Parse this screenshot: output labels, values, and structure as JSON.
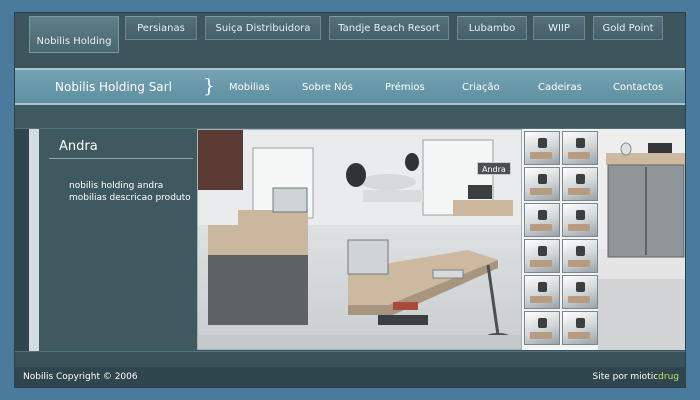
{
  "top_tabs": [
    {
      "label": "Nobilis Holding",
      "active": true
    },
    {
      "label": "Persianas"
    },
    {
      "label": "Suiça Distribuidora"
    },
    {
      "label": "Tandje Beach Resort"
    },
    {
      "label": "Lubambo"
    },
    {
      "label": "WIIP"
    },
    {
      "label": "Gold Point"
    }
  ],
  "brand": "Nobilis Holding Sarl",
  "brace": "}",
  "nav": [
    "Mobilias",
    "Sobre Nós",
    "Prémios",
    "Criação",
    "Cadeiras",
    "Contactos"
  ],
  "product": {
    "title": "Andra",
    "desc_lines": [
      "nobilis holding andra",
      "mobilias descricao produto"
    ],
    "tag": "Andra"
  },
  "footer": {
    "copyright": "Nobilis Copyright © 2006",
    "credit_prefix": "Site por miotic",
    "credit_accent": "drug"
  },
  "colors": {
    "accent": "#b9e35a",
    "nav": "#6b9aab",
    "panel": "#3f5961"
  }
}
